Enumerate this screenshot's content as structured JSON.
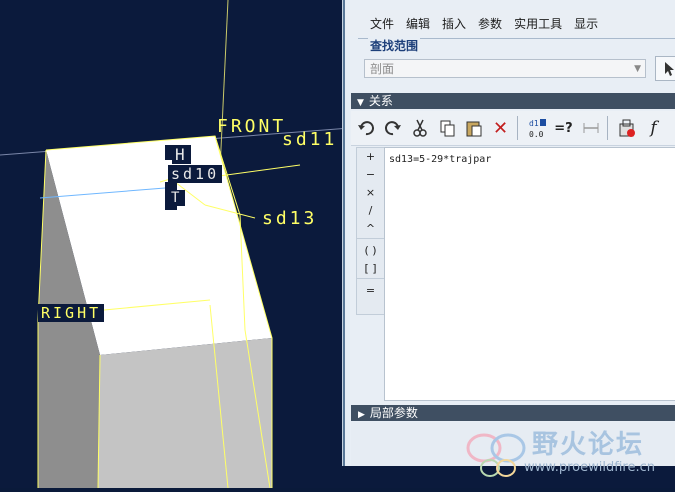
{
  "viewport": {
    "labels": {
      "front": "FRONT",
      "sd11": "sd11",
      "h": "H",
      "sd10": "sd10",
      "sd13": "sd13",
      "right": "RIGHT",
      "t": "T"
    }
  },
  "dialog": {
    "menu": [
      "文件",
      "编辑",
      "插入",
      "参数",
      "实用工具",
      "显示"
    ],
    "lookin": {
      "title": "查找范围",
      "value": "剖面"
    },
    "relations_header": "关系",
    "toolbar_icons": [
      "undo-icon",
      "redo-icon",
      "cut-icon",
      "copy-icon",
      "paste-icon",
      "delete-icon",
      "switch-dimensions-icon",
      "evaluate-icon",
      "sort-icon",
      "verify-icon",
      "function-icon"
    ],
    "operators": [
      "+",
      "−",
      "×",
      "/",
      "^",
      "( )",
      "[ ]",
      "="
    ],
    "relation_text": "sd13=5-29*trajpar",
    "local_params_header": "局部参数"
  },
  "watermark": {
    "title": "野火论坛",
    "url": "www.proewildfire.cn"
  },
  "colors": {
    "viewport_bg": "#0b1a3c",
    "header_bg": "#3f4f62",
    "dialog_bg": "#e8eef5",
    "edge_yellow": "#ffff66"
  }
}
